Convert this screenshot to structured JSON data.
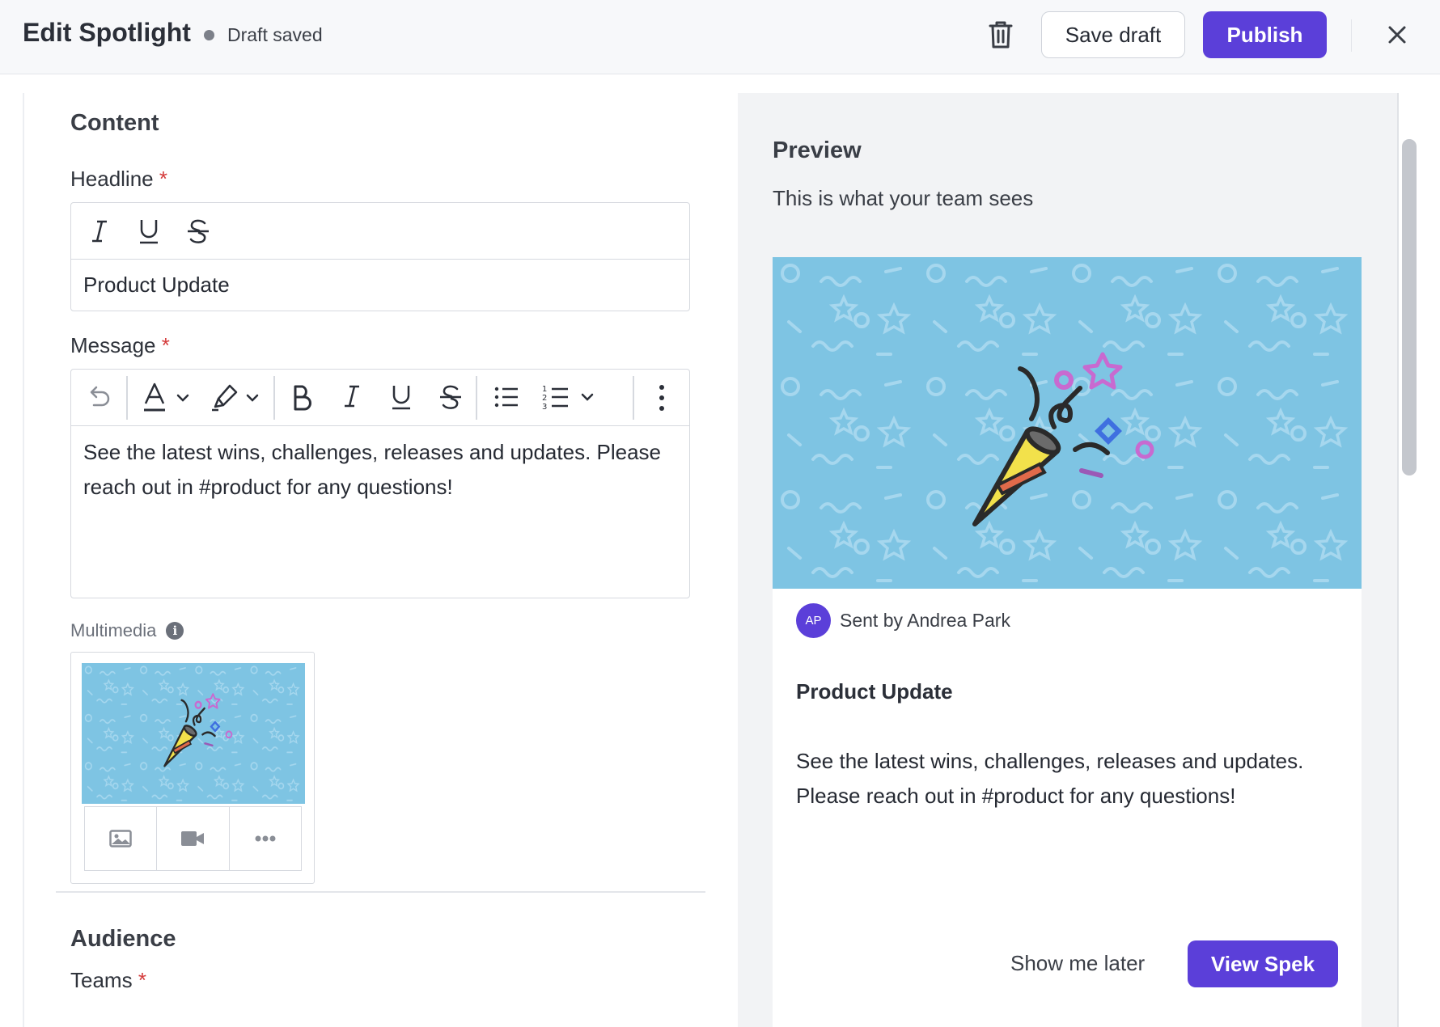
{
  "header": {
    "title": "Edit Spotlight",
    "status": "Draft saved",
    "save_draft": "Save draft",
    "publish": "Publish",
    "delete_icon": "trash-icon",
    "close_icon": "close-icon"
  },
  "content": {
    "section_title": "Content",
    "headline_label": "Headline",
    "headline_value": "Product Update",
    "message_label": "Message",
    "message_value": "See the latest wins, challenges, releases and updates. Please reach out in #product for any questions!",
    "multimedia_label": "Multimedia",
    "headline_toolbar": [
      "italic-icon",
      "underline-icon",
      "strikethrough-icon"
    ],
    "message_toolbar": [
      "undo-icon",
      "text-color-icon",
      "highlight-icon",
      "bold-icon",
      "italic-icon",
      "underline-icon",
      "strikethrough-icon",
      "bullet-list-icon",
      "numbered-list-icon",
      "more-vertical-icon"
    ],
    "multimedia_actions": [
      "image-icon",
      "video-icon",
      "more-horizontal-icon"
    ]
  },
  "audience": {
    "section_title": "Audience",
    "teams_label": "Teams"
  },
  "required_marker": "*",
  "preview": {
    "title": "Preview",
    "subtitle": "This is what your team sees",
    "avatar_initials": "AP",
    "sent_by": "Sent by Andrea Park",
    "headline": "Product Update",
    "message": "See the latest wins, challenges, releases and updates. Please reach out in #product for any questions!",
    "show_later": "Show me later",
    "view_button": "View Spek"
  },
  "colors": {
    "accent": "#5b3fd9",
    "banner_bg": "#7ec4e3",
    "required": "#d43b3b"
  }
}
